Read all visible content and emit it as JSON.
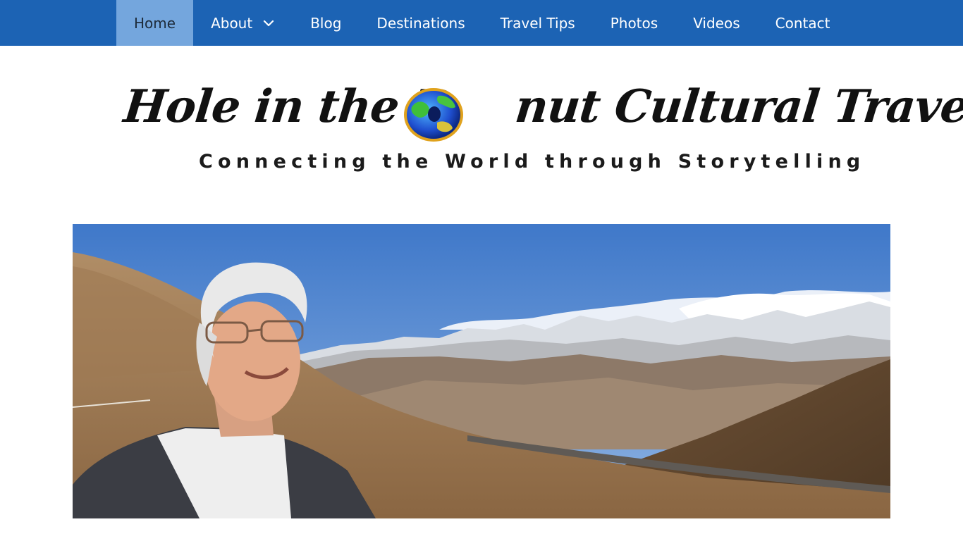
{
  "nav": {
    "items": [
      {
        "label": "Home",
        "active": true
      },
      {
        "label": "About",
        "has_dropdown": true
      },
      {
        "label": "Blog"
      },
      {
        "label": "Destinations"
      },
      {
        "label": "Travel Tips"
      },
      {
        "label": "Photos"
      },
      {
        "label": "Videos"
      },
      {
        "label": "Contact"
      }
    ],
    "bar_color": "#1c63b4",
    "active_color": "#74a6dd"
  },
  "logo": {
    "title_part1": "Hole in the D",
    "title_part2": "nut Cultural Travel",
    "tagline": "Connecting the World through Storytelling",
    "globe_icon": "globe-donut-icon"
  },
  "hero": {
    "image": "portrait-woman-himalaya-mountains"
  }
}
